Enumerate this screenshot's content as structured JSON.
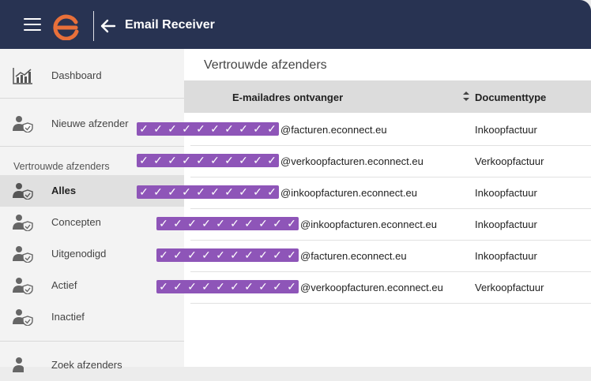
{
  "header": {
    "title": "Email Receiver"
  },
  "sidebar": {
    "items": [
      {
        "label": "Dashboard"
      },
      {
        "label": "Nieuwe afzender"
      },
      {
        "label": "Alles"
      },
      {
        "label": "Concepten"
      },
      {
        "label": "Uitgenodigd"
      },
      {
        "label": "Actief"
      },
      {
        "label": "Inactief"
      },
      {
        "label": "Zoek afzenders"
      }
    ],
    "section_label": "Vertrouwde afzenders",
    "active_item": "Alles"
  },
  "main": {
    "title": "Vertrouwde afzenders",
    "columns": [
      "E-mailadres ontvanger",
      "Documenttype"
    ],
    "rows": [
      {
        "email": "@facturen.econnect.eu",
        "doctype": "Inkoopfactuur"
      },
      {
        "email": "@verkoopfacturen.econnect.eu",
        "doctype": "Verkoopfactuur"
      },
      {
        "email": "@inkoopfacturen.econnect.eu",
        "doctype": "Inkoopfactuur"
      },
      {
        "email": "@inkoopfacturen.econnect.eu",
        "doctype": "Inkoopfactuur"
      },
      {
        "email": "@facturen.econnect.eu",
        "doctype": "Inkoopfactuur"
      },
      {
        "email": "@verkoopfacturen.econnect.eu",
        "doctype": "Verkoopfactuur"
      }
    ]
  },
  "colors": {
    "topbar": "#283352",
    "logo": "#e8703a",
    "redaction": "#8e55b8"
  },
  "icons": {
    "menu": "hamburger-icon",
    "logo": "e-logo",
    "back": "arrow-left-icon",
    "dashboard": "chart-icon",
    "person": "user-shield-icon",
    "sort": "sort-icon"
  }
}
